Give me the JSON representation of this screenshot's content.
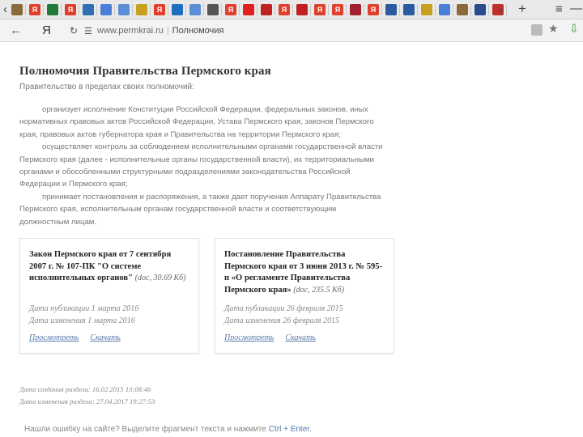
{
  "browser": {
    "tabs": [
      {
        "icon": "pc-icon",
        "label": "",
        "bg": "#8a6a3a"
      },
      {
        "icon": "yandex-icon",
        "label": "Я",
        "bg": "#e0402b"
      },
      {
        "icon": "shield-icon",
        "label": "",
        "bg": "#1f7a3a"
      },
      {
        "icon": "yandex-icon",
        "label": "Я",
        "bg": "#e0402b"
      },
      {
        "icon": "shield-icon",
        "label": "",
        "bg": "#2f6fb5"
      },
      {
        "icon": "grid-icon",
        "label": "",
        "bg": "#4a7ed8"
      },
      {
        "icon": "grid-icon",
        "label": "",
        "bg": "#5a8fd8"
      },
      {
        "icon": "mail-icon",
        "label": "",
        "bg": "#c8a020"
      },
      {
        "icon": "yandex-icon",
        "label": "Я",
        "bg": "#e0402b"
      },
      {
        "icon": "bookmark-icon",
        "label": "",
        "bg": "#1f6fc0"
      },
      {
        "icon": "grid-icon",
        "label": "",
        "bg": "#5a8fd8"
      },
      {
        "icon": "document-icon",
        "label": "",
        "bg": "#555555"
      },
      {
        "icon": "yandex-icon",
        "label": "Я",
        "bg": "#e0402b"
      },
      {
        "icon": "play-icon",
        "label": "",
        "bg": "#e02020"
      },
      {
        "icon": "alert-icon",
        "label": "",
        "bg": "#c02020"
      },
      {
        "icon": "yandex-icon",
        "label": "Я",
        "bg": "#e0402b"
      },
      {
        "icon": "stop-icon",
        "label": "",
        "bg": "#c02020"
      },
      {
        "icon": "yandex-icon",
        "label": "Я",
        "bg": "#e0402b"
      },
      {
        "icon": "yandex-icon",
        "label": "Я",
        "bg": "#e0402b"
      },
      {
        "icon": "building-icon",
        "label": "",
        "bg": "#a02030"
      },
      {
        "icon": "yandex-icon",
        "label": "Я",
        "bg": "#e0402b"
      },
      {
        "icon": "plane-icon",
        "label": "",
        "bg": "#2a5aa0"
      },
      {
        "icon": "emblem-icon",
        "label": "",
        "bg": "#2a5aa0"
      },
      {
        "icon": "arrow-icon",
        "label": "",
        "bg": "#c8a020"
      },
      {
        "icon": "grid-icon",
        "label": "",
        "bg": "#4a7ed8"
      },
      {
        "icon": "emblem-icon",
        "label": "",
        "bg": "#8a6a3a"
      },
      {
        "icon": "castle-icon",
        "label": "",
        "bg": "#2a4a90"
      },
      {
        "icon": "emblem-icon",
        "label": "",
        "bg": "#c0302a"
      }
    ],
    "url_domain": "www.permkrai.ru",
    "page_title": "Полномочия",
    "back_label": "←",
    "yandex_label": "Я",
    "forward_label": "›",
    "new_tab_label": "+",
    "menu_label": "≡",
    "minimize_label": "—",
    "reload_label": "↻"
  },
  "page": {
    "heading": "Полномочия Правительства Пермского края",
    "intro": "Правительство в пределах своих полномочий:",
    "paragraphs": [
      {
        "lines": [
          "организует исполнение Конституции Российской Федерации, федеральных законов, иных",
          "нормативных правовых актов Российской Федерации, Устава Пермского края, законов Пермского",
          "края, правовых актов губернатора края и Правительства на территории Пермского края;"
        ]
      },
      {
        "lines": [
          "осуществляет контроль за соблюдением исполнительными органами государственной власти",
          "Пермского края (далее - исполнительные органы государственной власти), их территориальными",
          "органами и обособленными структурными подразделениями законодательства Российской",
          "Федерации и Пермского края;"
        ]
      },
      {
        "lines": [
          "принимает постановления и распоряжения, а также дает поручения Аппарату Правительства",
          "Пермского края, исполнительным органам государственной власти и соответствующим",
          "должностным лицам."
        ]
      }
    ],
    "cards": [
      {
        "title": "Закон Пермского края от 7 сентября 2007 г. № 107-ПК \"О системе исполнительных органов\"",
        "meta": "(doc, 30.69 Кб)",
        "published": "Дата публикации 1 марта 2016",
        "modified": "Дата изменения 1 марта 2016",
        "view": "Просмотреть",
        "download": "Скачать"
      },
      {
        "title": "Постановление Правительства Пермского края от 3 июня 2013 г. № 595-п «О регламенте Правительства Пермского края»",
        "meta": "(doc, 235.5 Кб)",
        "published": "Дата публикации 26 февраля 2015",
        "modified": "Дата изменения 26 февраля 2015",
        "view": "Просмотреть",
        "download": "Скачать"
      }
    ],
    "created": "Дата создания раздела: 16.02.2015 13:08:46",
    "changed": "Дата изменения раздела: 27.04.2017 19:27:53",
    "error_text": "Нашли ошибку на сайте? Выделите фрагмент текста и нажмите",
    "error_keys": "Ctrl + Enter."
  }
}
